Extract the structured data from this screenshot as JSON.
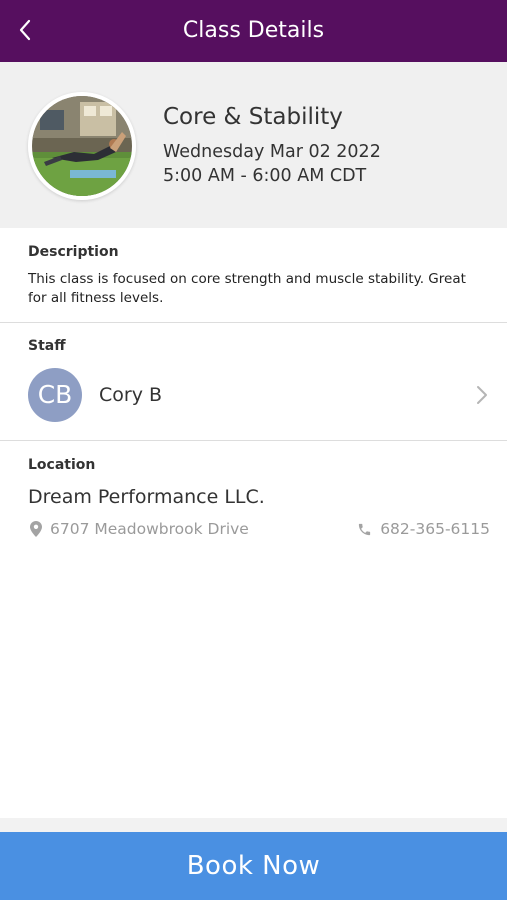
{
  "header": {
    "title": "Class Details",
    "back_icon": "chevron-left-icon",
    "background": "#560f5f"
  },
  "class_info": {
    "name": "Core & Stability",
    "date": "Wednesday Mar 02 2022",
    "time": "5:00 AM - 6:00 AM CDT"
  },
  "description": {
    "label": "Description",
    "text": "This class is focused on core strength and muscle stability. Great for all fitness levels."
  },
  "staff": {
    "label": "Staff",
    "initials": "CB",
    "name": "Cory B",
    "avatar_color": "#8e9ec4"
  },
  "location": {
    "label": "Location",
    "name": "Dream Performance LLC.",
    "address": "6707 Meadowbrook Drive",
    "phone": "682-365-6115"
  },
  "footer": {
    "book_label": "Book Now",
    "button_color": "#4a90e2"
  }
}
